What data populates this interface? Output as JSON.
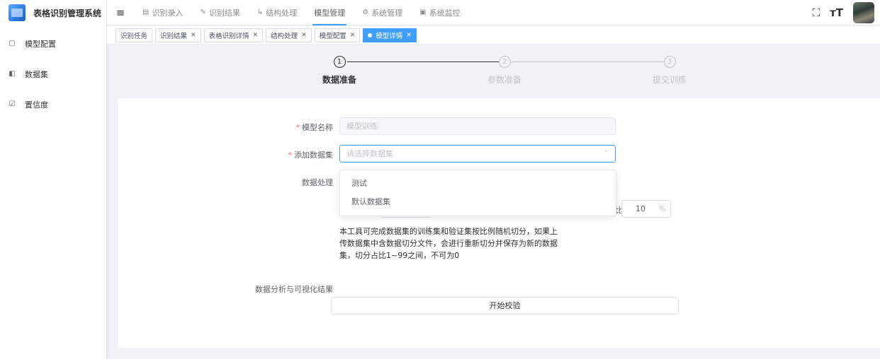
{
  "app": {
    "name": "表格识别管理系统"
  },
  "sidebar": {
    "items": [
      {
        "label": "模型配置",
        "icon": "monitor-icon"
      },
      {
        "label": "数据集",
        "icon": "copy-icon"
      },
      {
        "label": "置信度",
        "icon": "checkbox-icon"
      }
    ]
  },
  "topnav": {
    "items": [
      {
        "label": "识别录入",
        "icon": "printer-icon"
      },
      {
        "label": "识别结果",
        "icon": "edit-icon"
      },
      {
        "label": "结构处理",
        "icon": "tree-icon"
      },
      {
        "label": "模型管理",
        "icon": ""
      },
      {
        "label": "系统管理",
        "icon": "gear-icon"
      },
      {
        "label": "系统监控",
        "icon": "monitor-icon"
      }
    ],
    "active_index": 3
  },
  "tags": [
    {
      "label": "识别任务",
      "closable": false
    },
    {
      "label": "识别结果",
      "closable": true
    },
    {
      "label": "表格识别详情",
      "closable": true
    },
    {
      "label": "结构处理",
      "closable": true
    },
    {
      "label": "模型配置",
      "closable": true
    },
    {
      "label": "模型详情",
      "closable": true,
      "active": true
    }
  ],
  "steps": [
    {
      "num": "1",
      "title": "数据准备"
    },
    {
      "num": "2",
      "title": "参数准备"
    },
    {
      "num": "3",
      "title": "提交训练"
    }
  ],
  "active_step": 0,
  "form": {
    "model_name_label": "模型名称",
    "model_name_value": "模型训练",
    "dataset_label": "添加数据集",
    "dataset_placeholder": "请选择数据集",
    "dataset_options": [
      "测试",
      "默认数据集"
    ],
    "processing_label": "数据处理",
    "split_value": "10",
    "split_unit": "%",
    "split_trunc": "比",
    "description": "本工具可完成数据集的训练集和验证集按比例随机切分，如果上传数据集中含数据切分文件，会进行重新切分并保存为新的数据集，切分占比1~99之间，不可为0",
    "analysis_label": "数据分析与可视化结果",
    "start_button": "开始校验"
  },
  "colors": {
    "primary": "#409eff",
    "required": "#f56c6c"
  }
}
